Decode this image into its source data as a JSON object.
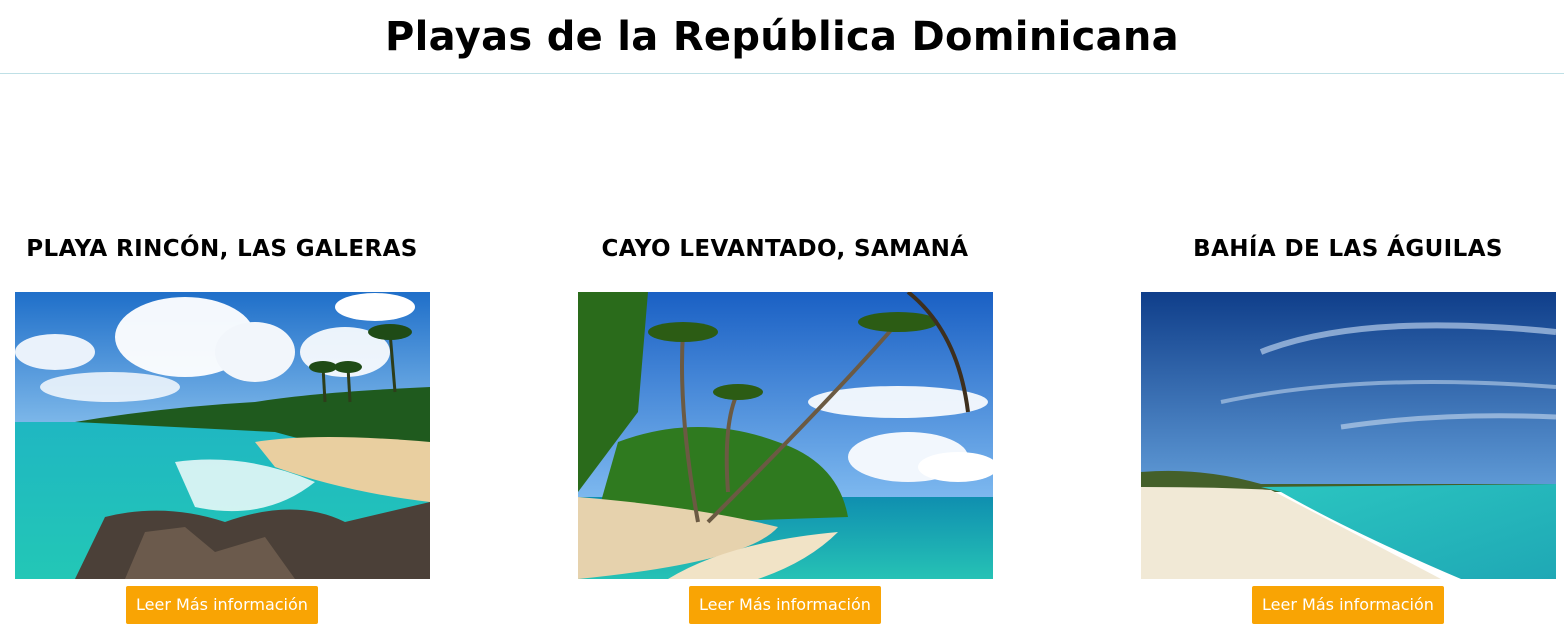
{
  "page": {
    "title": "Playas de la República Dominicana"
  },
  "beaches": [
    {
      "name": "PLAYA RINCÓN, LAS GALERAS",
      "button": "Leer Más información"
    },
    {
      "name": "CAYO LEVANTADO, SAMANÁ",
      "button": "Leer Más información"
    },
    {
      "name": "BAHÍA DE LAS ÁGUILAS",
      "button": "Leer Más información"
    }
  ],
  "colors": {
    "button_bg": "#f9a404",
    "button_text": "#ffffff",
    "header_border": "#bfe0e6"
  }
}
